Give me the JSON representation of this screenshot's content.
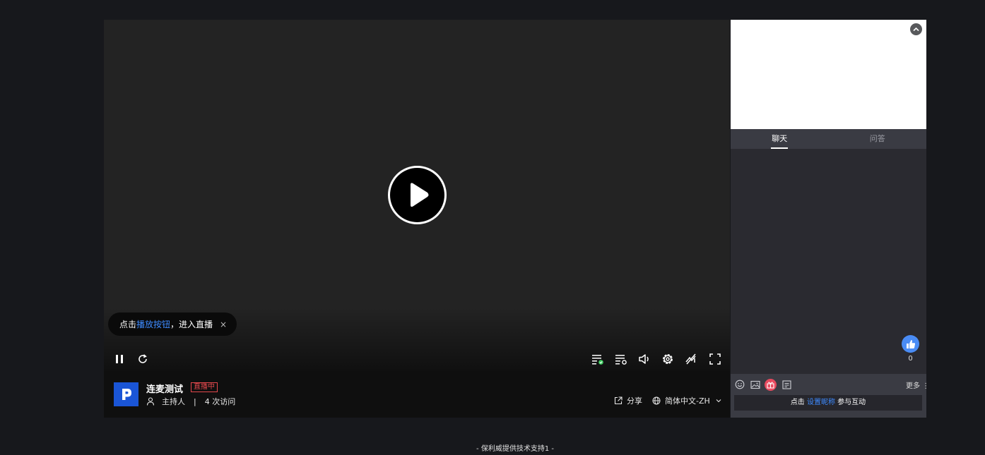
{
  "tip": {
    "prefix": "点击 ",
    "highlight": "播放按钮",
    "suffix": "，进入直播",
    "close": "×"
  },
  "controls": {
    "icons": [
      "pause-icon",
      "refresh-icon",
      "playlist-check-icon",
      "playlist-settings-icon",
      "volume-icon",
      "gear-icon",
      "danmaku-off-icon",
      "fullscreen-icon"
    ]
  },
  "info": {
    "title": "连麦测试",
    "live_badge": "直播中",
    "role": "主持人",
    "separator": "|",
    "visits": "4 次访问",
    "share": "分享",
    "language": "简体中文-ZH"
  },
  "panel": {
    "tabs": [
      {
        "label": "聊天",
        "active": true
      },
      {
        "label": "问答",
        "active": false
      }
    ],
    "like_count": "0",
    "more": "更多",
    "nick": {
      "prefix": "点击 ",
      "highlight": "设置昵称",
      "suffix": " 参与互动"
    }
  },
  "footer": {
    "text": "- 保利威提供技术支持1 -"
  },
  "colors": {
    "accent": "#3e8bff",
    "live": "#e5484d",
    "like": "#4a8cf5",
    "logo": "#1a55d6"
  }
}
